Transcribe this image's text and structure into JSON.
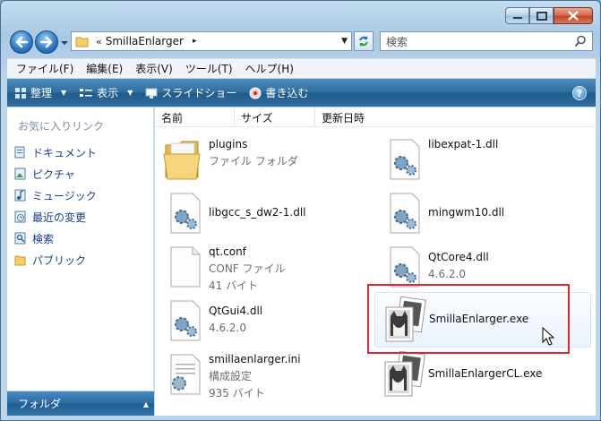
{
  "window": {
    "accent": "#2c6c9f"
  },
  "address": {
    "chevron": "«",
    "path": "SmillaEnlarger",
    "arrow": "▸"
  },
  "search": {
    "placeholder": "検索"
  },
  "menu": [
    "ファイル(F)",
    "編集(E)",
    "表示(V)",
    "ツール(T)",
    "ヘルプ(H)"
  ],
  "toolbar": {
    "organize": "整理",
    "views": "表示",
    "slideshow": "スライドショー",
    "burn": "書き込む",
    "help": "?"
  },
  "navpane": {
    "heading": "お気に入りリンク",
    "items": [
      {
        "label": "ドキュメント",
        "icon": "documents-icon"
      },
      {
        "label": "ピクチャ",
        "icon": "pictures-icon"
      },
      {
        "label": "ミュージック",
        "icon": "music-icon"
      },
      {
        "label": "最近の変更",
        "icon": "recent-icon"
      },
      {
        "label": "検索",
        "icon": "search-folder-icon"
      },
      {
        "label": "パブリック",
        "icon": "public-folder-icon"
      }
    ],
    "folders_label": "フォルダ"
  },
  "columns": {
    "name": "名前",
    "size": "サイズ",
    "date": "更新日時"
  },
  "files": [
    {
      "name": "plugins",
      "sub1": "ファイル フォルダ",
      "sub2": "",
      "icon": "folder-icon"
    },
    {
      "name": "libexpat-1.dll",
      "sub1": "",
      "sub2": "",
      "icon": "dll-icon"
    },
    {
      "name": "libgcc_s_dw2-1.dll",
      "sub1": "",
      "sub2": "",
      "icon": "dll-icon"
    },
    {
      "name": "mingwm10.dll",
      "sub1": "",
      "sub2": "",
      "icon": "dll-icon"
    },
    {
      "name": "qt.conf",
      "sub1": "CONF ファイル",
      "sub2": "41 バイト",
      "icon": "blank-file-icon"
    },
    {
      "name": "QtCore4.dll",
      "sub1": "4.6.2.0",
      "sub2": "",
      "icon": "dll-icon"
    },
    {
      "name": "QtGui4.dll",
      "sub1": "4.6.2.0",
      "sub2": "",
      "icon": "dll-icon"
    },
    {
      "name": "SmillaEnlarger.exe",
      "sub1": "",
      "sub2": "",
      "icon": "cat-photo-icon"
    },
    {
      "name": "smillaenlarger.ini",
      "sub1": "構成設定",
      "sub2": "935 バイト",
      "icon": "ini-file-icon"
    },
    {
      "name": "SmillaEnlargerCL.exe",
      "sub1": "",
      "sub2": "",
      "icon": "cat-photo-icon"
    }
  ]
}
